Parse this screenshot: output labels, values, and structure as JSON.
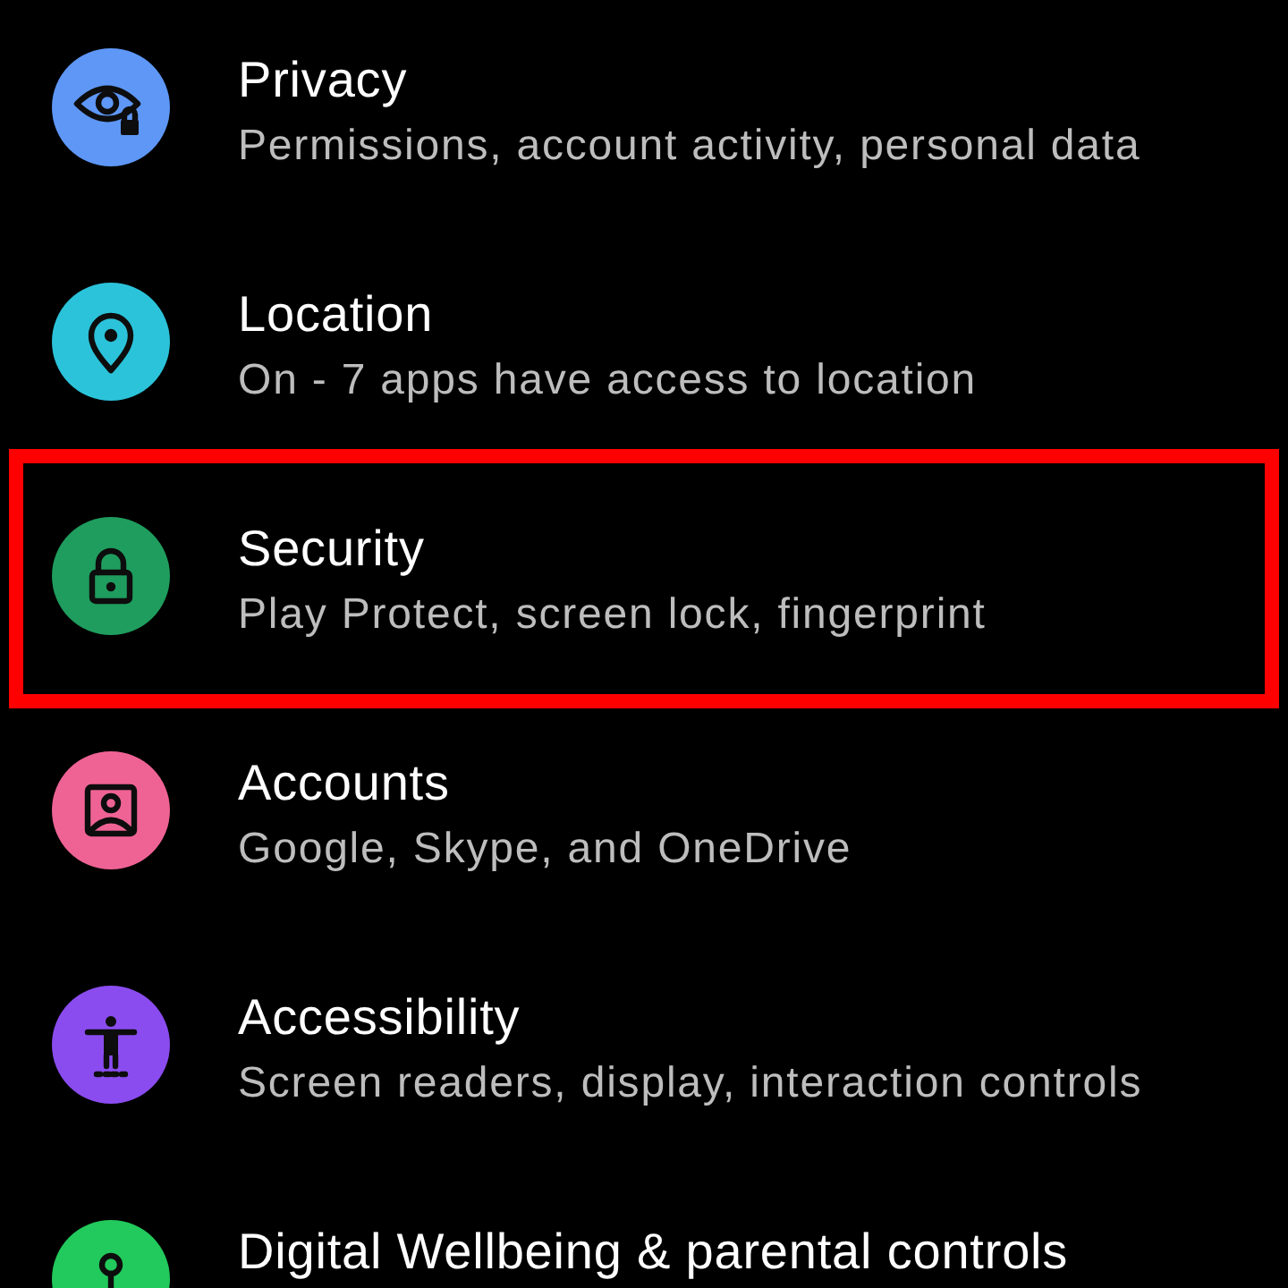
{
  "items": [
    {
      "title": "Privacy",
      "subtitle": "Permissions, account activity, personal data",
      "color": "#5e97f6",
      "highlighted": false
    },
    {
      "title": "Location",
      "subtitle": "On - 7 apps have access to location",
      "color": "#2bc3da",
      "highlighted": false
    },
    {
      "title": "Security",
      "subtitle": "Play Protect, screen lock, fingerprint",
      "color": "#1f9d5e",
      "highlighted": true
    },
    {
      "title": "Accounts",
      "subtitle": "Google, Skype, and OneDrive",
      "color": "#ef6394",
      "highlighted": false
    },
    {
      "title": "Accessibility",
      "subtitle": "Screen readers, display, interaction controls",
      "color": "#8a4cef",
      "highlighted": false
    },
    {
      "title": "Digital Wellbeing & parental controls",
      "color": "#22c95c",
      "highlighted": false
    }
  ]
}
